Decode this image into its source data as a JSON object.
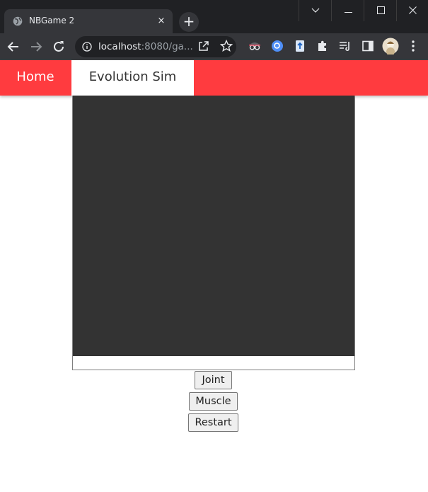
{
  "browser": {
    "tab_title": "NBGame 2",
    "tab_close": "×",
    "new_tab": "+",
    "url_host": "localhost",
    "url_rest": ":8080/ga...",
    "window_controls": {
      "dropdown": "⌵",
      "minimize": "─",
      "maximize": "☐",
      "close": "✕"
    }
  },
  "navbar": {
    "items": [
      {
        "label": "Home",
        "active": false
      },
      {
        "label": "Evolution Sim",
        "active": true
      }
    ],
    "color": "#ff3b3f"
  },
  "game": {
    "canvas_color": "#333333"
  },
  "controls": {
    "joint_label": "Joint",
    "muscle_label": "Muscle",
    "restart_label": "Restart"
  }
}
